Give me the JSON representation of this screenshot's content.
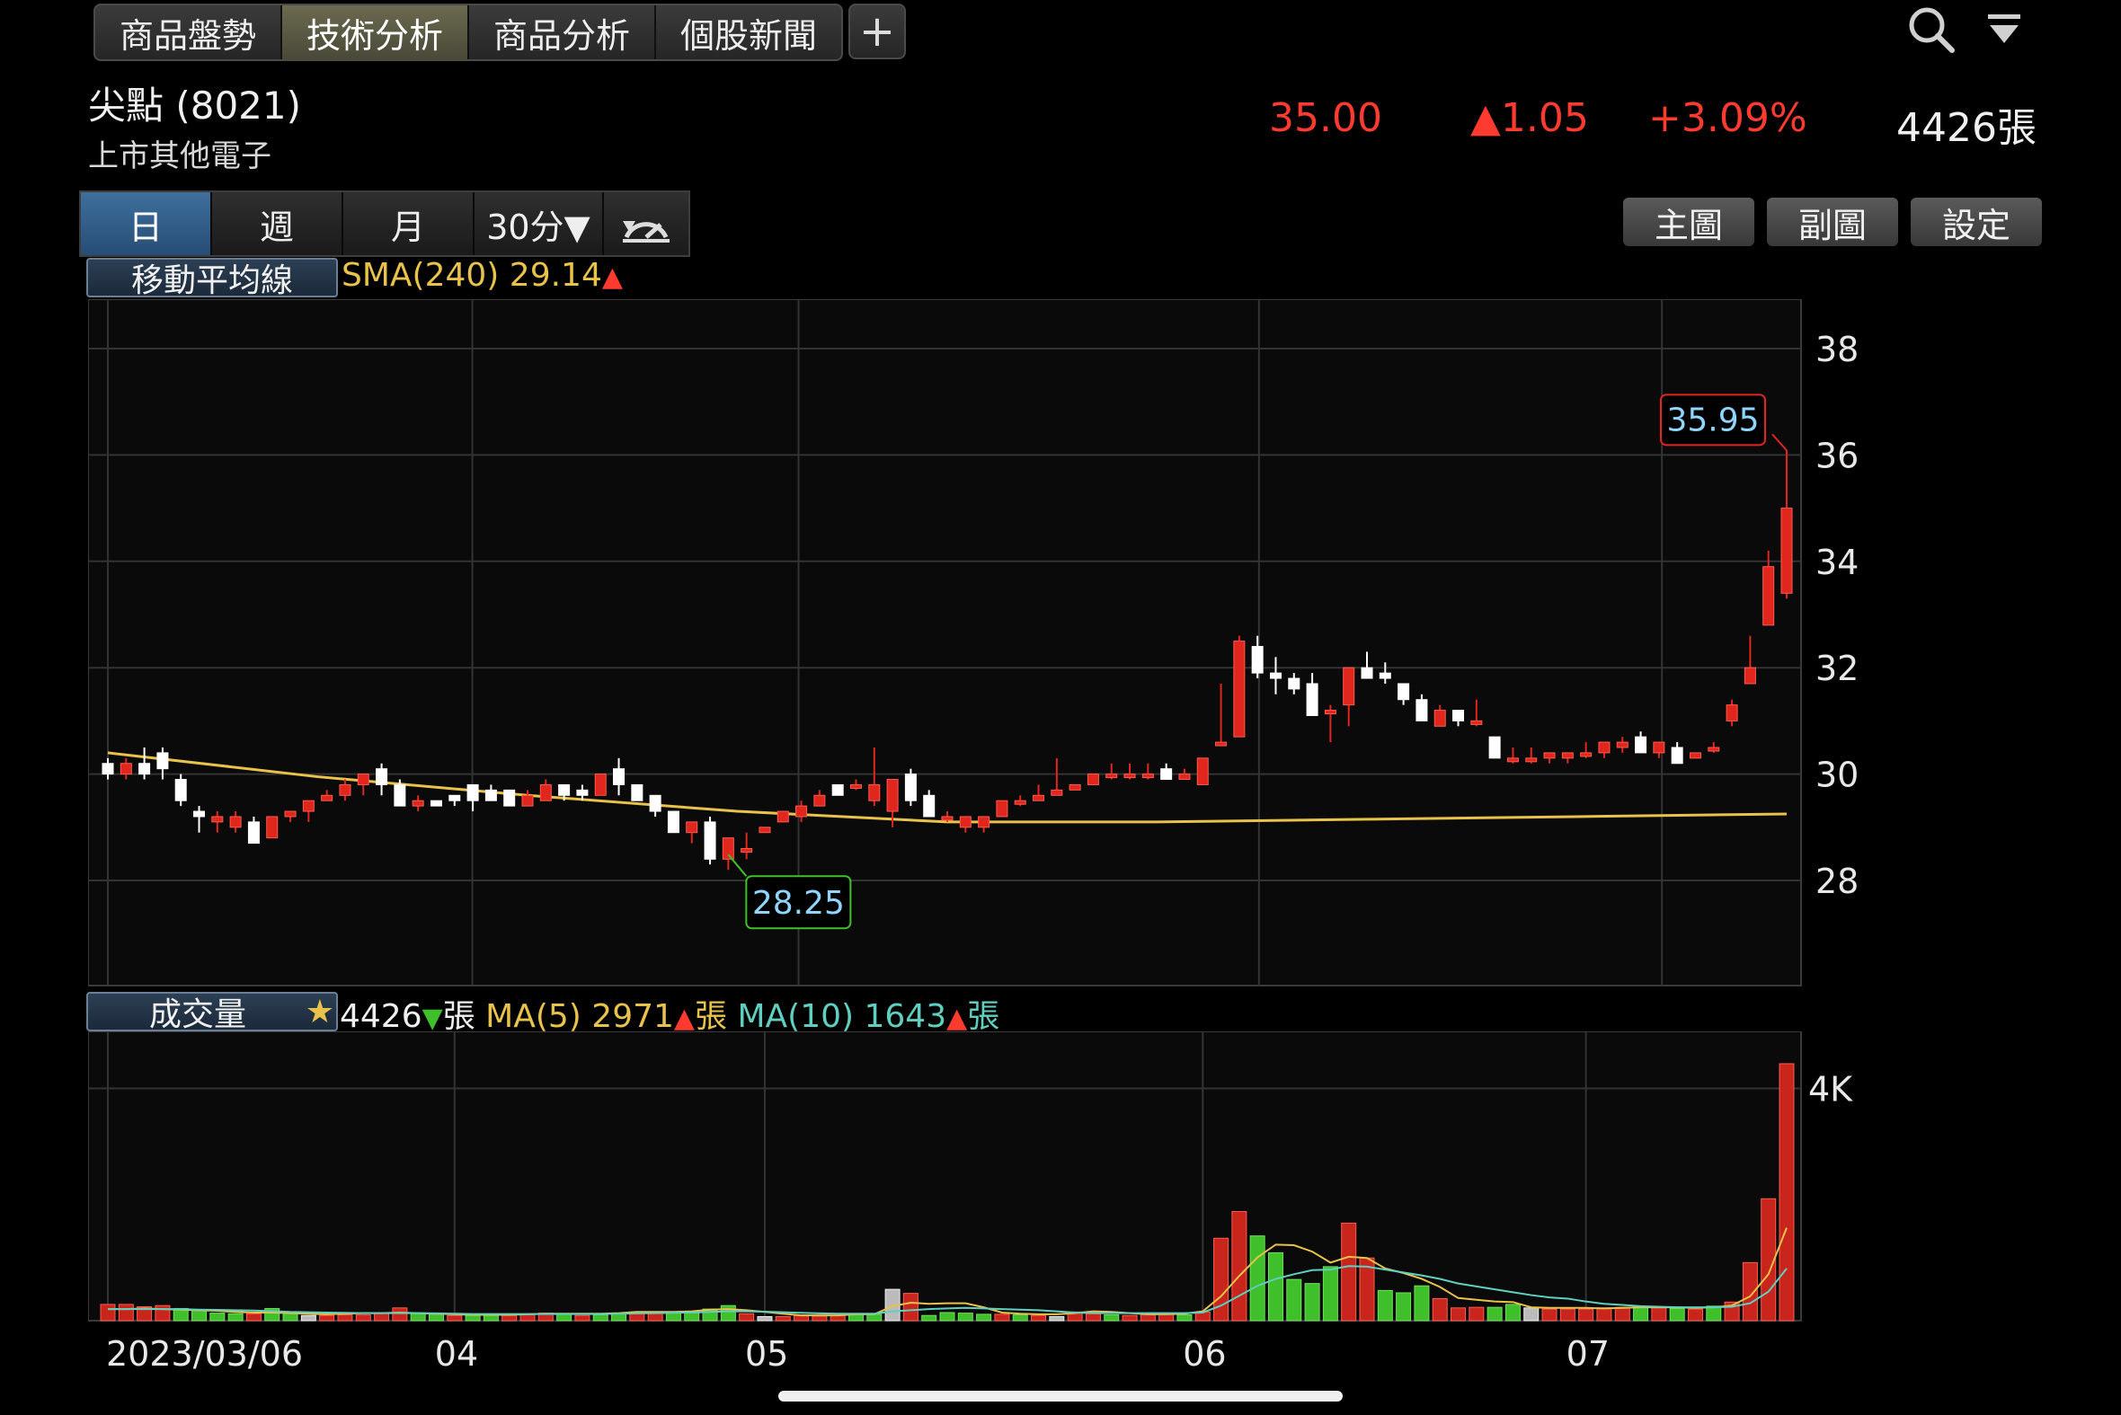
{
  "top_tabs": [
    "商品盤勢",
    "技術分析",
    "商品分析",
    "個股新聞"
  ],
  "plus_label": "+",
  "stock": {
    "name": "尖點 (8021)",
    "category": "上市其他電子"
  },
  "quote": {
    "price": "35.00",
    "change": "▲1.05",
    "change_pct": "+3.09%",
    "volume": "4426張"
  },
  "periods": [
    "日",
    "週",
    "月",
    "30分▼"
  ],
  "right_buttons": [
    "主圖",
    "副圖",
    "設定"
  ],
  "main_panel": {
    "label": "移動平均線",
    "indicator": "SMA(240) 29.14",
    "indicator_arrow": "▲",
    "high_marker": "35.95",
    "low_marker": "28.25",
    "y_ticks": [
      "38",
      "36",
      "34",
      "32",
      "30",
      "28"
    ]
  },
  "volume_panel": {
    "label": "成交量",
    "star": "★",
    "vol_text": "4426",
    "vol_arrow": "▼",
    "unit": "張",
    "ma5_text": "MA(5) 2971",
    "ma5_arrow": "▲",
    "ma10_text": "MA(10) 1643",
    "ma10_arrow": "▲",
    "y_tick": "4K"
  },
  "x_ticks": [
    "2023/03/06",
    "04",
    "05",
    "06",
    "07"
  ],
  "colors": {
    "up": "#e0261d",
    "down": "#ffffff",
    "sma": "#e8c24a",
    "ma10": "#5fd0c0",
    "vol_up": "#c8261c",
    "vol_down": "#3fbf2a"
  },
  "chart_data": {
    "type": "candlestick",
    "candles": [
      [
        30.2,
        30.0,
        30.3,
        29.9
      ],
      [
        30.0,
        30.2,
        30.3,
        29.9
      ],
      [
        30.2,
        30.0,
        30.5,
        29.9
      ],
      [
        30.4,
        30.1,
        30.5,
        29.9
      ],
      [
        29.9,
        29.5,
        30.0,
        29.4
      ],
      [
        29.3,
        29.2,
        29.4,
        28.9
      ],
      [
        29.1,
        29.2,
        29.3,
        28.9
      ],
      [
        29.0,
        29.2,
        29.3,
        28.9
      ],
      [
        29.1,
        28.7,
        29.2,
        28.7
      ],
      [
        28.8,
        29.2,
        29.2,
        28.8
      ],
      [
        29.2,
        29.3,
        29.3,
        29.1
      ],
      [
        29.3,
        29.5,
        29.5,
        29.1
      ],
      [
        29.5,
        29.6,
        29.7,
        29.5
      ],
      [
        29.6,
        29.8,
        29.9,
        29.5
      ],
      [
        29.8,
        30.0,
        30.0,
        29.6
      ],
      [
        30.1,
        29.8,
        30.2,
        29.6
      ],
      [
        29.8,
        29.4,
        29.9,
        29.4
      ],
      [
        29.4,
        29.5,
        29.6,
        29.3
      ],
      [
        29.5,
        29.4,
        29.5,
        29.4
      ],
      [
        29.6,
        29.5,
        29.6,
        29.4
      ],
      [
        29.8,
        29.5,
        29.8,
        29.3
      ],
      [
        29.7,
        29.5,
        29.8,
        29.5
      ],
      [
        29.7,
        29.4,
        29.7,
        29.4
      ],
      [
        29.4,
        29.6,
        29.7,
        29.4
      ],
      [
        29.5,
        29.8,
        29.9,
        29.5
      ],
      [
        29.8,
        29.6,
        29.8,
        29.5
      ],
      [
        29.7,
        29.6,
        29.8,
        29.5
      ],
      [
        29.6,
        30.0,
        30.0,
        29.6
      ],
      [
        30.1,
        29.8,
        30.3,
        29.6
      ],
      [
        29.8,
        29.5,
        29.8,
        29.5
      ],
      [
        29.6,
        29.3,
        29.6,
        29.2
      ],
      [
        29.3,
        28.9,
        29.3,
        28.9
      ],
      [
        28.9,
        29.1,
        29.1,
        28.7
      ],
      [
        29.1,
        28.4,
        29.2,
        28.3
      ],
      [
        28.4,
        28.8,
        28.8,
        28.2
      ],
      [
        28.6,
        28.6,
        28.9,
        28.4
      ],
      [
        28.9,
        29.0,
        29.0,
        28.9
      ],
      [
        29.1,
        29.3,
        29.3,
        29.1
      ],
      [
        29.2,
        29.4,
        29.5,
        29.1
      ],
      [
        29.4,
        29.6,
        29.7,
        29.4
      ],
      [
        29.8,
        29.6,
        29.8,
        29.6
      ],
      [
        29.8,
        29.8,
        29.9,
        29.7
      ],
      [
        29.5,
        29.8,
        30.5,
        29.4
      ],
      [
        29.3,
        29.9,
        29.9,
        29.0
      ],
      [
        30.0,
        29.5,
        30.1,
        29.4
      ],
      [
        29.6,
        29.2,
        29.7,
        29.2
      ],
      [
        29.2,
        29.2,
        29.3,
        29.1
      ],
      [
        29.0,
        29.2,
        29.2,
        28.9
      ],
      [
        29.0,
        29.2,
        29.2,
        28.9
      ],
      [
        29.2,
        29.5,
        29.5,
        29.2
      ],
      [
        29.5,
        29.5,
        29.6,
        29.4
      ],
      [
        29.5,
        29.6,
        29.8,
        29.5
      ],
      [
        29.6,
        29.7,
        30.3,
        29.6
      ],
      [
        29.7,
        29.8,
        29.8,
        29.7
      ],
      [
        29.8,
        30.0,
        30.0,
        29.8
      ],
      [
        30.0,
        30.0,
        30.2,
        29.9
      ],
      [
        30.0,
        30.0,
        30.2,
        29.9
      ],
      [
        30.0,
        30.0,
        30.2,
        29.9
      ],
      [
        30.1,
        29.9,
        30.2,
        29.9
      ],
      [
        29.9,
        30.0,
        30.1,
        29.9
      ],
      [
        29.8,
        30.3,
        30.3,
        29.8
      ],
      [
        30.6,
        30.6,
        31.7,
        30.6
      ],
      [
        30.7,
        32.5,
        32.6,
        30.7
      ],
      [
        32.4,
        31.9,
        32.6,
        31.8
      ],
      [
        31.9,
        31.8,
        32.2,
        31.5
      ],
      [
        31.8,
        31.6,
        31.9,
        31.5
      ],
      [
        31.7,
        31.1,
        31.9,
        31.1
      ],
      [
        31.2,
        31.2,
        31.3,
        30.6
      ],
      [
        31.3,
        32.0,
        32.0,
        30.9
      ],
      [
        32.0,
        31.8,
        32.3,
        31.8
      ],
      [
        31.9,
        31.8,
        32.1,
        31.7
      ],
      [
        31.7,
        31.4,
        31.7,
        31.3
      ],
      [
        31.4,
        31.0,
        31.5,
        31.0
      ],
      [
        30.9,
        31.2,
        31.3,
        30.9
      ],
      [
        31.2,
        31.0,
        31.2,
        30.9
      ],
      [
        31.0,
        31.0,
        31.4,
        30.9
      ],
      [
        30.7,
        30.3,
        30.7,
        30.3
      ],
      [
        30.3,
        30.3,
        30.5,
        30.2
      ],
      [
        30.3,
        30.3,
        30.5,
        30.2
      ],
      [
        30.3,
        30.4,
        30.4,
        30.2
      ],
      [
        30.3,
        30.4,
        30.4,
        30.2
      ],
      [
        30.4,
        30.4,
        30.6,
        30.3
      ],
      [
        30.4,
        30.6,
        30.6,
        30.3
      ],
      [
        30.5,
        30.6,
        30.7,
        30.4
      ],
      [
        30.7,
        30.4,
        30.8,
        30.4
      ],
      [
        30.4,
        30.6,
        30.6,
        30.3
      ],
      [
        30.5,
        30.2,
        30.6,
        30.2
      ],
      [
        30.3,
        30.4,
        30.4,
        30.3
      ],
      [
        30.5,
        30.5,
        30.6,
        30.4
      ],
      [
        31.0,
        31.3,
        31.4,
        30.9
      ],
      [
        31.7,
        32.0,
        32.6,
        31.7
      ],
      [
        32.8,
        33.9,
        34.2,
        32.8
      ],
      [
        33.4,
        35.0,
        35.95,
        33.3
      ]
    ],
    "sma240": [
      30.4,
      29.95,
      29.6,
      29.3,
      29.1,
      29.1,
      29.15,
      29.2,
      29.25
    ],
    "volume": [
      [
        280,
        "up"
      ],
      [
        280,
        "up"
      ],
      [
        240,
        "up"
      ],
      [
        260,
        "up"
      ],
      [
        210,
        "down"
      ],
      [
        190,
        "down"
      ],
      [
        130,
        "down"
      ],
      [
        120,
        "down"
      ],
      [
        120,
        "up"
      ],
      [
        210,
        "down"
      ],
      [
        130,
        "down"
      ],
      [
        90,
        "flat"
      ],
      [
        90,
        "up"
      ],
      [
        100,
        "up"
      ],
      [
        100,
        "up"
      ],
      [
        130,
        "up"
      ],
      [
        220,
        "up"
      ],
      [
        120,
        "down"
      ],
      [
        110,
        "down"
      ],
      [
        90,
        "up"
      ],
      [
        90,
        "down"
      ],
      [
        90,
        "down"
      ],
      [
        90,
        "up"
      ],
      [
        100,
        "up"
      ],
      [
        130,
        "up"
      ],
      [
        120,
        "down"
      ],
      [
        90,
        "up"
      ],
      [
        100,
        "down"
      ],
      [
        130,
        "down"
      ],
      [
        150,
        "up"
      ],
      [
        140,
        "up"
      ],
      [
        130,
        "down"
      ],
      [
        140,
        "down"
      ],
      [
        200,
        "down"
      ],
      [
        260,
        "down"
      ],
      [
        120,
        "up"
      ],
      [
        70,
        "flat"
      ],
      [
        70,
        "up"
      ],
      [
        90,
        "up"
      ],
      [
        80,
        "up"
      ],
      [
        90,
        "up"
      ],
      [
        110,
        "down"
      ],
      [
        110,
        "down"
      ],
      [
        540,
        "flat"
      ],
      [
        470,
        "up"
      ],
      [
        90,
        "down"
      ],
      [
        140,
        "down"
      ],
      [
        130,
        "down"
      ],
      [
        110,
        "down"
      ],
      [
        110,
        "up"
      ],
      [
        100,
        "down"
      ],
      [
        90,
        "up"
      ],
      [
        70,
        "flat"
      ],
      [
        150,
        "up"
      ],
      [
        120,
        "up"
      ],
      [
        100,
        "down"
      ],
      [
        90,
        "up"
      ],
      [
        100,
        "up"
      ],
      [
        110,
        "up"
      ],
      [
        100,
        "down"
      ],
      [
        150,
        "up"
      ],
      [
        1420,
        "up"
      ],
      [
        1880,
        "up"
      ],
      [
        1460,
        "down"
      ],
      [
        1170,
        "down"
      ],
      [
        710,
        "down"
      ],
      [
        640,
        "down"
      ],
      [
        930,
        "down"
      ],
      [
        1680,
        "up"
      ],
      [
        1080,
        "up"
      ],
      [
        520,
        "down"
      ],
      [
        480,
        "down"
      ],
      [
        600,
        "down"
      ],
      [
        380,
        "up"
      ],
      [
        220,
        "up"
      ],
      [
        230,
        "up"
      ],
      [
        230,
        "down"
      ],
      [
        280,
        "down"
      ],
      [
        220,
        "flat"
      ],
      [
        200,
        "up"
      ],
      [
        200,
        "up"
      ],
      [
        200,
        "up"
      ],
      [
        220,
        "up"
      ],
      [
        230,
        "up"
      ],
      [
        240,
        "down"
      ],
      [
        220,
        "up"
      ],
      [
        210,
        "down"
      ],
      [
        200,
        "up"
      ],
      [
        250,
        "down"
      ],
      [
        320,
        "up"
      ],
      [
        1000,
        "up"
      ],
      [
        2100,
        "up"
      ],
      [
        4426,
        "up"
      ]
    ],
    "ma5": [
      200,
      200,
      210,
      200,
      190,
      180,
      170,
      150,
      140,
      140,
      130,
      120,
      110,
      120,
      130,
      130,
      140,
      130,
      120,
      110,
      100,
      100,
      100,
      110,
      120,
      120,
      120,
      120,
      130,
      150,
      150,
      150,
      160,
      190,
      200,
      180,
      150,
      120,
      90,
      90,
      90,
      110,
      110,
      250,
      310,
      290,
      300,
      300,
      230,
      140,
      120,
      110,
      110,
      130,
      160,
      150,
      130,
      110,
      110,
      120,
      160,
      420,
      770,
      1090,
      1310,
      1300,
      1190,
      1000,
      1100,
      1080,
      900,
      820,
      720,
      580,
      390,
      360,
      330,
      320,
      230,
      220,
      220,
      220,
      210,
      220,
      230,
      230,
      230,
      220,
      230,
      260,
      420,
      800,
      1600
    ],
    "ma10": [
      200,
      200,
      200,
      200,
      200,
      190,
      185,
      180,
      175,
      165,
      150,
      145,
      140,
      135,
      130,
      130,
      130,
      130,
      125,
      120,
      115,
      115,
      115,
      115,
      115,
      115,
      115,
      115,
      120,
      125,
      130,
      135,
      140,
      150,
      160,
      160,
      155,
      145,
      135,
      125,
      120,
      120,
      120,
      160,
      180,
      200,
      210,
      220,
      210,
      200,
      190,
      180,
      160,
      140,
      130,
      130,
      130,
      130,
      130,
      130,
      140,
      260,
      430,
      600,
      720,
      800,
      870,
      880,
      940,
      930,
      880,
      830,
      780,
      720,
      640,
      590,
      540,
      490,
      440,
      400,
      380,
      330,
      290,
      270,
      250,
      240,
      230,
      230,
      230,
      240,
      300,
      500,
      900
    ]
  }
}
